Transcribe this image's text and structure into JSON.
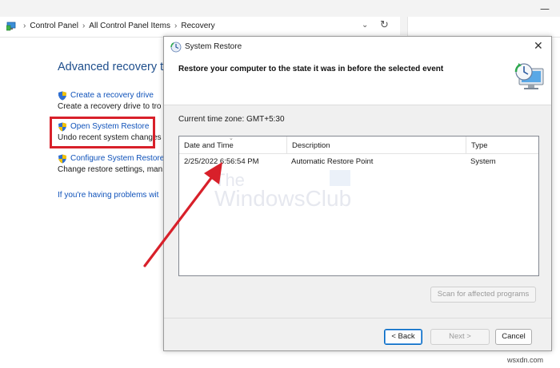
{
  "address_bar": {
    "breadcrumbs": [
      "Control Panel",
      "All Control Panel Items",
      "Recovery"
    ],
    "icon": "control-panel-icon"
  },
  "recovery": {
    "title": "Advanced recovery too",
    "items": [
      {
        "link": "Create a recovery drive",
        "desc": "Create a recovery drive to tro"
      },
      {
        "link": "Open System Restore",
        "desc": "Undo recent system changes"
      },
      {
        "link": "Configure System Restore",
        "desc": "Change restore settings, man"
      }
    ],
    "help_link": "If you're having problems wit"
  },
  "dialog": {
    "title": "System Restore",
    "heading": "Restore your computer to the state it was in before the selected event",
    "timezone": "Current time zone: GMT+5:30",
    "columns": [
      "Date and Time",
      "Description",
      "Type"
    ],
    "rows": [
      {
        "date": "2/25/2022 6:56:54 PM",
        "description": "Automatic Restore Point",
        "type": "System"
      }
    ],
    "scan_button": "Scan for affected programs",
    "back_button": "< Back",
    "next_button": "Next >",
    "cancel_button": "Cancel"
  },
  "watermark": {
    "line1": "The",
    "line2": "WindowsClub"
  },
  "credit": "wsxdn.com",
  "colors": {
    "highlight": "#d8202a",
    "link": "#0f52ba",
    "title": "#1e4e8c"
  }
}
